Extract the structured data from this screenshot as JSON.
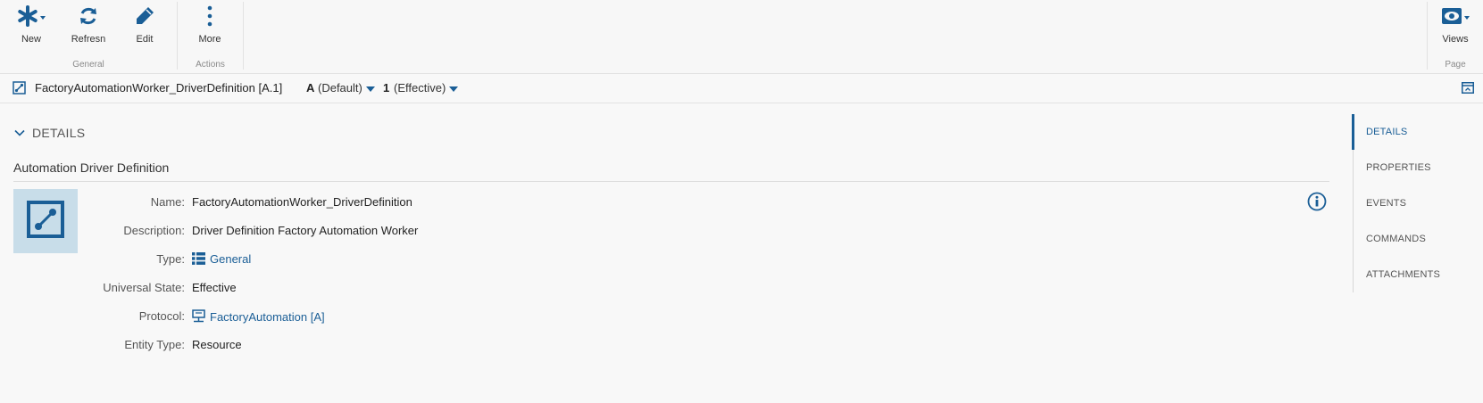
{
  "toolbar": {
    "groups": [
      {
        "label": "General",
        "buttons": [
          {
            "label": "New",
            "icon": "asterisk-icon"
          },
          {
            "label": "Refresn",
            "icon": "refresh-icon"
          },
          {
            "label": "Edit",
            "icon": "pencil-icon"
          }
        ]
      },
      {
        "label": "Actions",
        "buttons": [
          {
            "label": "More",
            "icon": "vertical-dots-icon"
          }
        ]
      },
      {
        "label": "Page",
        "buttons": [
          {
            "label": "Views",
            "icon": "eye-icon"
          }
        ]
      }
    ]
  },
  "entity": {
    "title": "FactoryAutomationWorker_DriverDefinition [A.1]",
    "revision": "A",
    "revision_state": "(Default)",
    "version": "1",
    "version_state": "(Effective)"
  },
  "details": {
    "section_label": "DETAILS",
    "subtitle": "Automation Driver Definition",
    "properties": [
      {
        "label": "Name:",
        "value": "FactoryAutomationWorker_DriverDefinition",
        "link": false
      },
      {
        "label": "Description:",
        "value": "Driver Definition Factory Automation Worker",
        "link": false
      },
      {
        "label": "Type:",
        "value": "General",
        "link": true,
        "icon": "list-icon"
      },
      {
        "label": "Universal State:",
        "value": "Effective",
        "link": false
      },
      {
        "label": "Protocol:",
        "value": "FactoryAutomation [A]",
        "link": true,
        "icon": "protocol-icon"
      },
      {
        "label": "Entity Type:",
        "value": "Resource",
        "link": false
      }
    ]
  },
  "right_nav": {
    "items": [
      "DETAILS",
      "PROPERTIES",
      "EVENTS",
      "COMMANDS",
      "ATTACHMENTS"
    ],
    "active": "DETAILS"
  },
  "colors": {
    "accent": "#1a5e96",
    "thumb_bg": "#c8dde9"
  }
}
